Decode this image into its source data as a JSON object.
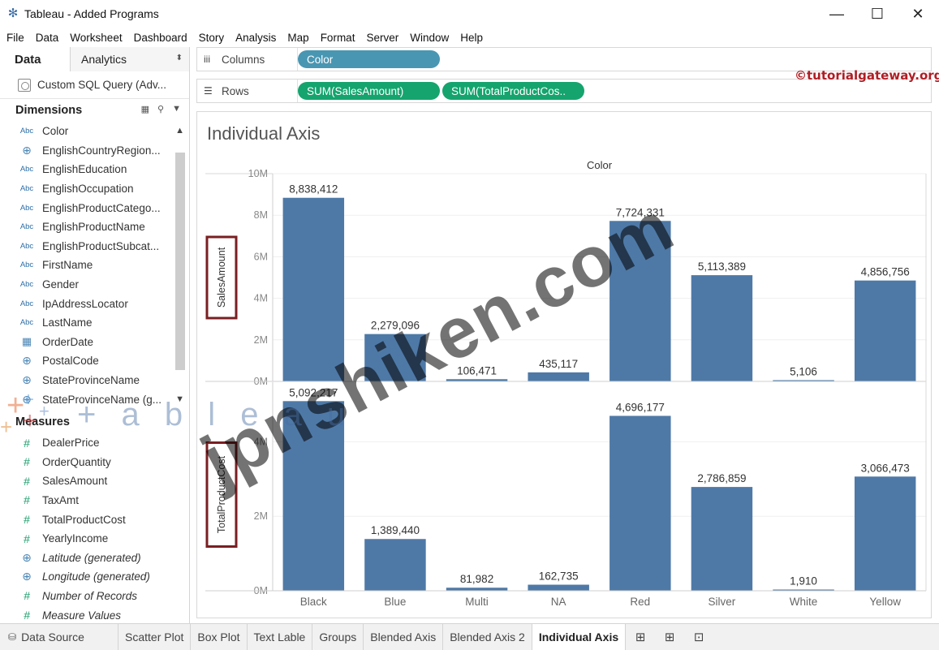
{
  "window": {
    "title": "Tableau - Added Programs",
    "icon": "tableau-logo-icon"
  },
  "menu": [
    "File",
    "Data",
    "Worksheet",
    "Dashboard",
    "Story",
    "Analysis",
    "Map",
    "Format",
    "Server",
    "Window",
    "Help"
  ],
  "left_pane": {
    "tabs": {
      "data": "Data",
      "analytics": "Analytics"
    },
    "data_source": "Custom SQL Query (Adv...",
    "dimensions_header": "Dimensions",
    "dimensions": [
      {
        "type": "Abc",
        "name": "Color"
      },
      {
        "type": "globe",
        "name": "EnglishCountryRegion..."
      },
      {
        "type": "Abc",
        "name": "EnglishEducation"
      },
      {
        "type": "Abc",
        "name": "EnglishOccupation"
      },
      {
        "type": "Abc",
        "name": "EnglishProductCatego..."
      },
      {
        "type": "Abc",
        "name": "EnglishProductName"
      },
      {
        "type": "Abc",
        "name": "EnglishProductSubcat..."
      },
      {
        "type": "Abc",
        "name": "FirstName"
      },
      {
        "type": "Abc",
        "name": "Gender"
      },
      {
        "type": "Abc",
        "name": "IpAddressLocator"
      },
      {
        "type": "Abc",
        "name": "LastName"
      },
      {
        "type": "calendar",
        "name": "OrderDate"
      },
      {
        "type": "globe",
        "name": "PostalCode"
      },
      {
        "type": "globe",
        "name": "StateProvinceName"
      },
      {
        "type": "globe",
        "name": "StateProvinceName (g..."
      }
    ],
    "measures_header": "Measures",
    "measures": [
      {
        "type": "#",
        "name": "DealerPrice",
        "italic": false
      },
      {
        "type": "#",
        "name": "OrderQuantity",
        "italic": false
      },
      {
        "type": "#",
        "name": "SalesAmount",
        "italic": false
      },
      {
        "type": "#",
        "name": "TaxAmt",
        "italic": false
      },
      {
        "type": "#",
        "name": "TotalProductCost",
        "italic": false
      },
      {
        "type": "#",
        "name": "YearlyIncome",
        "italic": false
      },
      {
        "type": "globe",
        "name": "Latitude (generated)",
        "italic": true
      },
      {
        "type": "globe",
        "name": "Longitude (generated)",
        "italic": true
      },
      {
        "type": "#",
        "name": "Number of Records",
        "italic": true
      },
      {
        "type": "#",
        "name": "Measure Values",
        "italic": true
      }
    ]
  },
  "shelves": {
    "columns_label": "Columns",
    "rows_label": "Rows",
    "columns_pills": [
      "Color"
    ],
    "rows_pills": [
      "SUM(SalesAmount)",
      "SUM(TotalProductCos.."
    ]
  },
  "watermark_site": "©tutorialgateway.org",
  "overlay_text": {
    "jpnshiken": "jpnshiken.com",
    "tableau": "+ a b l e a u"
  },
  "viz": {
    "title": "Individual Axis",
    "column_header": "Color"
  },
  "chart_data": {
    "type": "bar",
    "categories": [
      "Black",
      "Blue",
      "Multi",
      "NA",
      "Red",
      "Silver",
      "White",
      "Yellow"
    ],
    "xlabel": "Color",
    "series": [
      {
        "name": "SalesAmount",
        "values": [
          8838412,
          2279096,
          106471,
          435117,
          7724331,
          5113389,
          5106,
          4856756
        ],
        "labels": [
          "8,838,412",
          "2,279,096",
          "106,471",
          "435,117",
          "7,724,331",
          "5,113,389",
          "5,106",
          "4,856,756"
        ],
        "ylim": [
          0,
          10000000
        ],
        "ticks": [
          0,
          2000000,
          4000000,
          6000000,
          8000000,
          10000000
        ],
        "tick_labels": [
          "0M",
          "2M",
          "4M",
          "6M",
          "8M",
          "10M"
        ]
      },
      {
        "name": "TotalProductCost",
        "values": [
          5092217,
          1389440,
          81982,
          162735,
          4696177,
          2786859,
          1910,
          3066473
        ],
        "labels": [
          "5,092,217",
          "1,389,440",
          "81,982",
          "162,735",
          "4,696,177",
          "2,786,859",
          "1,910",
          "3,066,473"
        ],
        "ylim": [
          0,
          5600000
        ],
        "ticks": [
          0,
          2000000,
          4000000
        ],
        "tick_labels": [
          "0M",
          "2M",
          "4M"
        ]
      }
    ],
    "bar_color": "#4e79a7",
    "grid": true
  },
  "sheet_tabs": [
    {
      "label": "Data Source",
      "icon": "database-icon",
      "active": false
    },
    {
      "label": "Scatter Plot",
      "active": false
    },
    {
      "label": "Box Plot",
      "active": false
    },
    {
      "label": "Text Lable",
      "active": false
    },
    {
      "label": "Groups",
      "active": false
    },
    {
      "label": "Blended Axis",
      "active": false
    },
    {
      "label": "Blended Axis 2",
      "active": false
    },
    {
      "label": "Individual Axis",
      "active": true
    }
  ],
  "new_tab_icons": [
    "new-worksheet-icon",
    "new-dashboard-icon",
    "new-story-icon"
  ]
}
